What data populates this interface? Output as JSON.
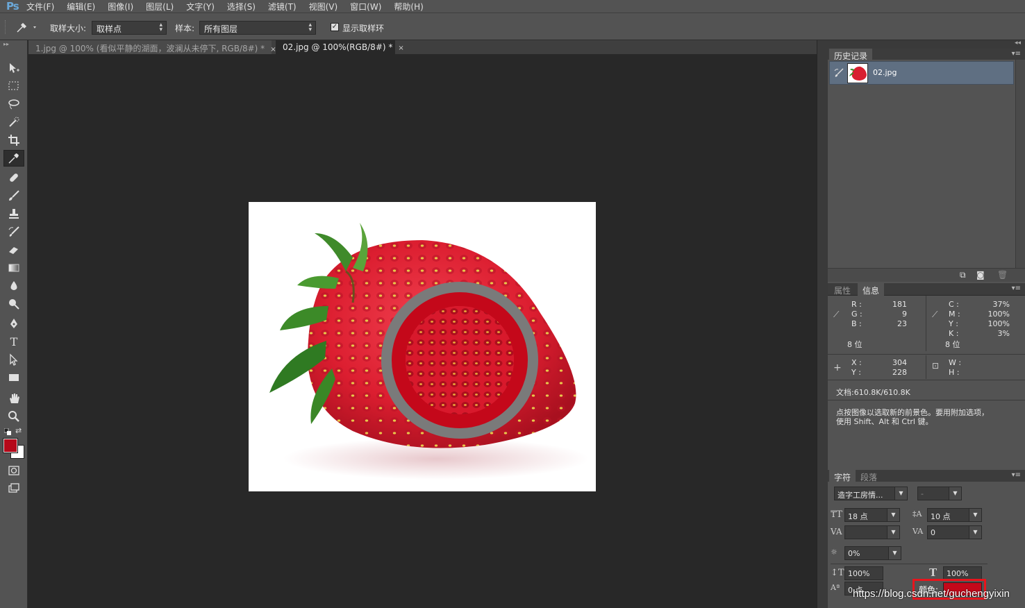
{
  "app": {
    "logo": "Ps"
  },
  "menu": [
    "文件(F)",
    "编辑(E)",
    "图像(I)",
    "图层(L)",
    "文字(Y)",
    "选择(S)",
    "滤镜(T)",
    "视图(V)",
    "窗口(W)",
    "帮助(H)"
  ],
  "options": {
    "sample_size_label": "取样大小:",
    "sample_size_value": "取样点",
    "sample_label": "样本:",
    "sample_value": "所有图层",
    "show_ring_label": "显示取样环",
    "show_ring_checked": true
  },
  "tabs": [
    {
      "label": "1.jpg @ 100% (看似平静的湖面，波澜从未停下, RGB/8#) *",
      "active": false
    },
    {
      "label": "02.jpg @ 100%(RGB/8#) *",
      "active": true
    }
  ],
  "tab_close_glyph": "×",
  "colors": {
    "foreground": "#b5091a",
    "background": "#ffffff",
    "sampled": "#c4081a",
    "ring_outer": "#7a7a7a",
    "highlight_box": "#e8141c"
  },
  "history": {
    "tab_label": "历史记录",
    "item_label": "02.jpg"
  },
  "info_panel": {
    "tab_properties": "属性",
    "tab_info": "信息",
    "rgb": {
      "r_label": "R :",
      "g_label": "G :",
      "b_label": "B :",
      "r": "181",
      "g": "9",
      "b": "23",
      "bits": "8 位"
    },
    "cmyk": {
      "c_label": "C :",
      "m_label": "M :",
      "y_label": "Y :",
      "k_label": "K :",
      "c": "37%",
      "m": "100%",
      "y": "100%",
      "k": "3%",
      "bits": "8 位"
    },
    "coords": {
      "x_label": "X :",
      "y_label": "Y :",
      "x": "304",
      "y": "228",
      "w_label": "W :",
      "h_label": "H :"
    },
    "doc_size": "文档:610.8K/610.8K",
    "hint_line1": "点按图像以选取新的前景色。要用附加选项，",
    "hint_line2": "使用 Shift、Alt 和 Ctrl 键。"
  },
  "character": {
    "tab_char": "字符",
    "tab_para": "段落",
    "font": "造字工房情...",
    "style": "-",
    "size": "18 点",
    "leading": "10 点",
    "kerning": "",
    "tracking": "0",
    "scale_pct": "0%",
    "vscale": "100%",
    "hscale": "100%",
    "baseline": "0 点",
    "color_label": "颜色:"
  },
  "icons": [
    "eyedropper-icon",
    "move-icon",
    "marquee-icon",
    "lasso-icon",
    "quick-select-icon",
    "crop-icon",
    "heal-icon",
    "brush-icon",
    "stamp-icon",
    "history-brush-icon",
    "eraser-icon",
    "gradient-icon",
    "blur-icon",
    "dodge-icon",
    "pen-icon",
    "type-icon",
    "path-select-icon",
    "rectangle-icon",
    "hand-icon",
    "zoom-icon"
  ],
  "watermark": "https://blog.csdn.net/guchengyixin"
}
